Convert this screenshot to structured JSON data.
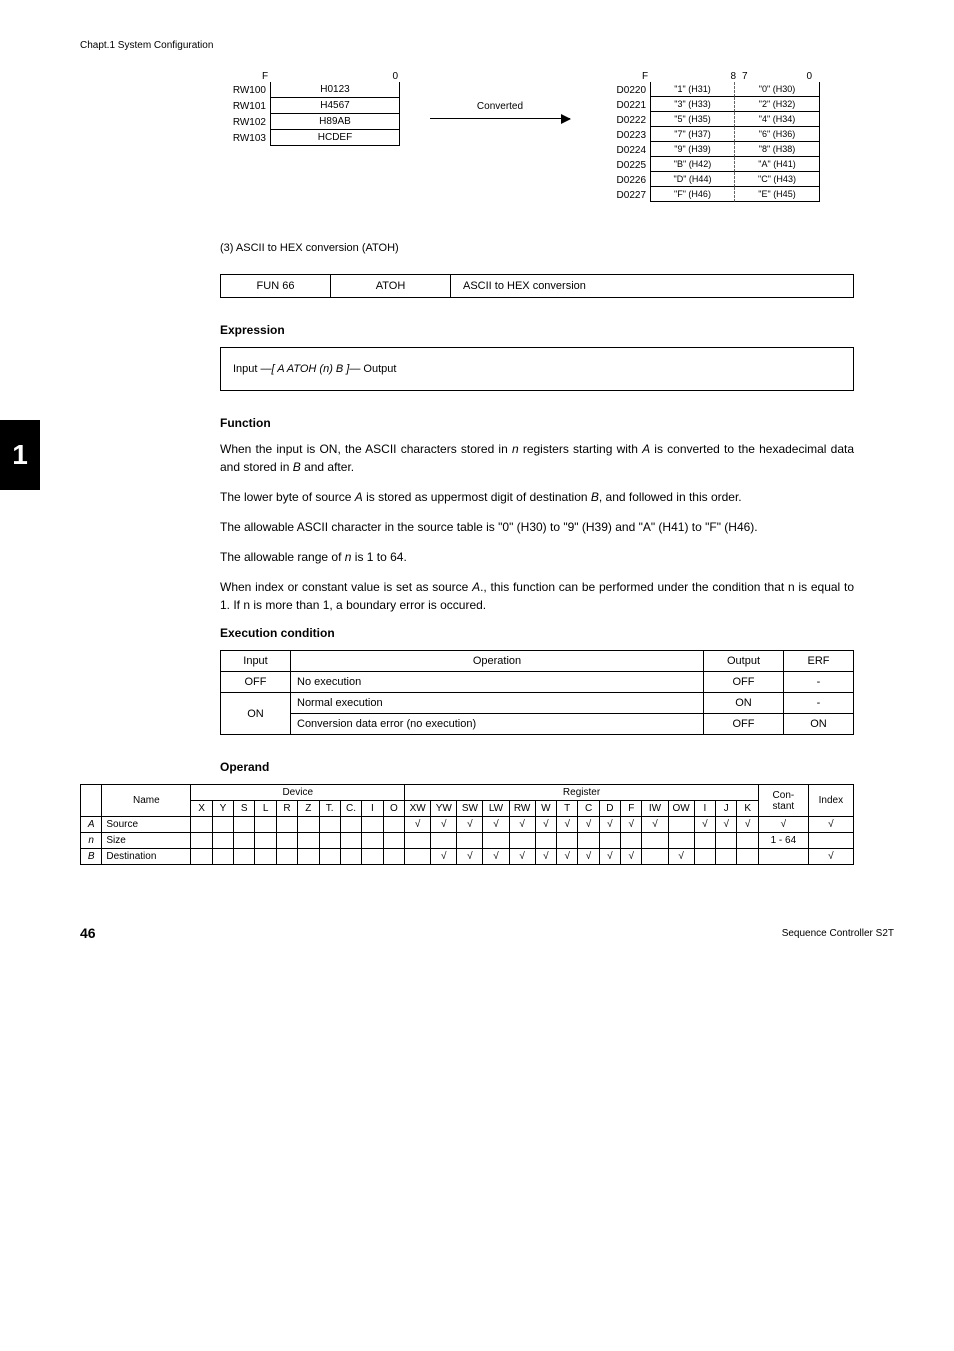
{
  "header": "Chapt.1  System Configuration",
  "sidebar_num": "1",
  "diagram": {
    "src_bits": [
      "F",
      "0"
    ],
    "dst_bits": [
      "F",
      "8",
      "7",
      "0"
    ],
    "arrow_label": "Converted",
    "src": [
      {
        "label": "RW100",
        "val": "H0123"
      },
      {
        "label": "RW101",
        "val": "H4567"
      },
      {
        "label": "RW102",
        "val": "H89AB"
      },
      {
        "label": "RW103",
        "val": "HCDEF"
      }
    ],
    "dst": [
      {
        "label": "D0220",
        "hi": "\"1\" (H31)",
        "lo": "\"0\" (H30)"
      },
      {
        "label": "D0221",
        "hi": "\"3\" (H33)",
        "lo": "\"2\" (H32)"
      },
      {
        "label": "D0222",
        "hi": "\"5\" (H35)",
        "lo": "\"4\" (H34)"
      },
      {
        "label": "D0223",
        "hi": "\"7\" (H37)",
        "lo": "\"6\" (H36)"
      },
      {
        "label": "D0224",
        "hi": "\"9\" (H39)",
        "lo": "\"8\" (H38)"
      },
      {
        "label": "D0225",
        "hi": "\"B\" (H42)",
        "lo": "\"A\" (H41)"
      },
      {
        "label": "D0226",
        "hi": "\"D\" (H44)",
        "lo": "\"C\" (H43)"
      },
      {
        "label": "D0227",
        "hi": "\"F\" (H46)",
        "lo": "\"E\" (H45)"
      }
    ]
  },
  "section_title": "(3)   ASCII to HEX conversion (ATOH)",
  "fun": {
    "num": "FUN 66",
    "name": "ATOH",
    "desc": "ASCII to HEX conversion"
  },
  "expression": {
    "title": "Expression",
    "text_pre": "Input ",
    "text_mid": "[ A ATOH (n)  B ]",
    "text_post": " Output"
  },
  "function": {
    "title": "Function",
    "p1_a": "When the input is ON, the ASCII characters stored in ",
    "p1_b": " registers starting with ",
    "p1_c": " is converted to the hexadecimal data and stored in ",
    "p1_d": " and after.",
    "p2_a": "The lower byte of source ",
    "p2_b": " is stored as uppermost digit of destination ",
    "p2_c": ", and followed in this order.",
    "p3": "The allowable ASCII character in the source table is \"0\" (H30) to \"9\" (H39) and \"A\" (H41) to \"F\" (H46).",
    "p4_a": "The allowable range of ",
    "p4_b": " is 1 to 64.",
    "p5_a": "When index or constant value is set as source ",
    "p5_b": "., this function can be performed under the condition that n is equal to 1. If n is more than 1, a boundary error is occured.",
    "n": "n",
    "A": "A",
    "B": "B"
  },
  "exec": {
    "title": "Execution condition",
    "h": {
      "input": "Input",
      "op": "Operation",
      "output": "Output",
      "erf": "ERF"
    },
    "r1": {
      "input": "OFF",
      "op": "No execution",
      "output": "OFF",
      "erf": "-"
    },
    "r2": {
      "input": "ON",
      "op": "Normal execution",
      "output": "ON",
      "erf": "-"
    },
    "r3": {
      "input": "",
      "op": "Conversion data error (no execution)",
      "output": "OFF",
      "erf": "ON"
    }
  },
  "operand": {
    "title": "Operand",
    "headers": {
      "name": "Name",
      "device": "Device",
      "register": "Register",
      "constant": "Con-\nstant",
      "index": "Index",
      "dev": [
        "X",
        "Y",
        "S",
        "L",
        "R",
        "Z",
        "T.",
        "C.",
        "I",
        "O"
      ],
      "reg": [
        "XW",
        "YW",
        "SW",
        "LW",
        "RW",
        "W",
        "T",
        "C",
        "D",
        "F",
        "IW",
        "OW",
        "I",
        "J",
        "K"
      ]
    },
    "rows": [
      {
        "k": "A",
        "name": "Source",
        "reg": [
          "√",
          "√",
          "√",
          "√",
          "√",
          "√",
          "√",
          "√",
          "√",
          "√",
          "√",
          "",
          "√",
          "√",
          "√"
        ],
        "const": "√",
        "index": "√"
      },
      {
        "k": "n",
        "name": "Size",
        "reg": [
          "",
          "",
          "",
          "",
          "",
          "",
          "",
          "",
          "",
          "",
          "",
          "",
          "",
          "",
          ""
        ],
        "const": "1 - 64",
        "index": ""
      },
      {
        "k": "B",
        "name": "Destination",
        "reg": [
          "",
          "√",
          "√",
          "√",
          "√",
          "√",
          "√",
          "√",
          "√",
          "√",
          "",
          "√",
          "",
          "",
          ""
        ],
        "const": "",
        "index": "√"
      }
    ]
  },
  "footer": {
    "page": "46",
    "text": "Sequence Controller S2T"
  }
}
